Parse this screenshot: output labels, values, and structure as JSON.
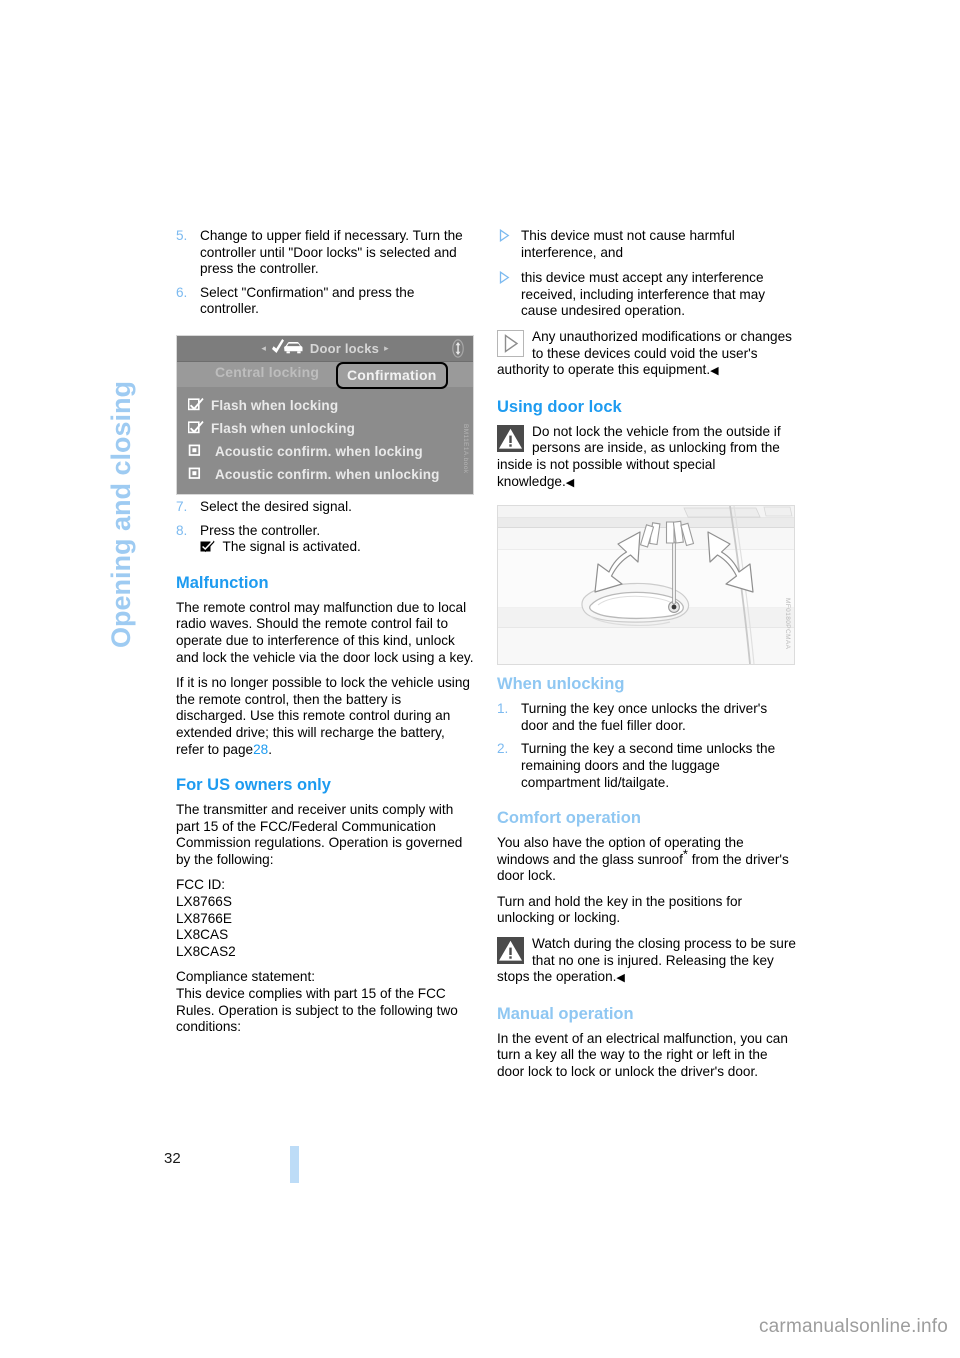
{
  "document": {
    "chapter_title": "Opening and closing",
    "page_number": "32",
    "watermark": "carmanualsonline.info"
  },
  "left_column": {
    "steps_top": [
      {
        "num": "5.",
        "text": "Change to upper field if necessary. Turn the controller until \"Door locks\" is selected and press the controller."
      },
      {
        "num": "6.",
        "text": "Select \"Confirmation\" and press the controller."
      }
    ],
    "steps_bottom": [
      {
        "num": "7.",
        "text": "Select the desired signal."
      },
      {
        "num": "8.",
        "text": "Press the controller."
      }
    ],
    "step8_note": "The signal is activated.",
    "malfunction": {
      "heading": "Malfunction",
      "paragraph1": "The remote control may malfunction due to local radio waves. Should the remote control fail to operate due to interference of this kind, unlock and lock the vehicle via the door lock using a key.",
      "paragraph2_before": "If it is no longer possible to lock the vehicle using the remote control, then the battery is discharged. Use this remote control during an extended drive; this will recharge the battery, refer to page",
      "paragraph2_pageref": "28",
      "paragraph2_after": "."
    },
    "us_owners": {
      "heading": "For US owners only",
      "paragraph1": "The transmitter and receiver units comply with part 15 of the FCC/Federal Communication Commission regulations. Operation is governed by the following:",
      "fcc_id_label": "FCC ID:",
      "fcc_ids": [
        "LX8766S",
        "LX8766E",
        "LX8CAS",
        "LX8CAS2"
      ],
      "compliance_label": "Compliance statement:",
      "compliance_text": "This device complies with part 15 of the FCC Rules. Operation is subject to the following two conditions:"
    }
  },
  "idrive_screen": {
    "header_title": "Door locks",
    "header_left_arrow": "◂",
    "header_right_arrow": "▸",
    "tab_inactive": "Central locking",
    "tab_active": "Confirmation",
    "options": [
      {
        "label": "Flash when locking",
        "checked": true
      },
      {
        "label": "Flash when unlocking",
        "checked": true
      },
      {
        "label": "Acoustic confirm. when locking",
        "checked": false
      },
      {
        "label": "Acoustic confirm. when unlocking",
        "checked": false
      }
    ],
    "figure_code": "ВМ11Е1А.book",
    "icons": {
      "car_icon": "car-with-check-icon",
      "scroll_icon": "scroll-up-down-icon"
    }
  },
  "right_column": {
    "fcc_conditions": [
      "This device must not cause harmful interference, and",
      "this device must accept any interference received, including interference that may cause undesired operation."
    ],
    "unauthorized_note": "Any unauthorized modifications or changes to these devices could void the user's authority to operate this equipment.",
    "using_door_lock": {
      "heading": "Using door lock",
      "warning": "Do not lock the vehicle from the outside if persons are inside, as unlocking from the inside is not possible without special knowledge."
    },
    "door_figure": {
      "code": "MF0180PCMAA",
      "description": "door-handle-key-turn-illustration"
    },
    "when_unlocking": {
      "heading": "When unlocking",
      "steps": [
        {
          "num": "1.",
          "text": "Turning the key once unlocks the driver's door and the fuel filler door."
        },
        {
          "num": "2.",
          "text": "Turning the key a second time unlocks the remaining doors and the luggage compartment lid/tailgate."
        }
      ]
    },
    "comfort_operation": {
      "heading": "Comfort operation",
      "paragraph1_before": "You also have the option of operating the windows and the glass sunroof",
      "paragraph1_star": "*",
      "paragraph1_after": " from the driver's door lock.",
      "paragraph2": "Turn and hold the key in the positions for unlocking or locking.",
      "warning": "Watch during the closing process to be sure that no one is injured. Releasing the key stops the operation."
    },
    "manual_operation": {
      "heading": "Manual operation",
      "paragraph": "In the event of an electrical malfunction, you can turn a key all the way to the right or left in the door lock to lock or unlock the driver's door."
    }
  },
  "colors": {
    "heading_blue_strong": "#1d9bf0",
    "heading_blue_soft": "#8fc7f2",
    "chapter_blue": "#9ecbf2",
    "page_bar": "#bddcf7",
    "watermark_gray": "#9d9d9d"
  }
}
